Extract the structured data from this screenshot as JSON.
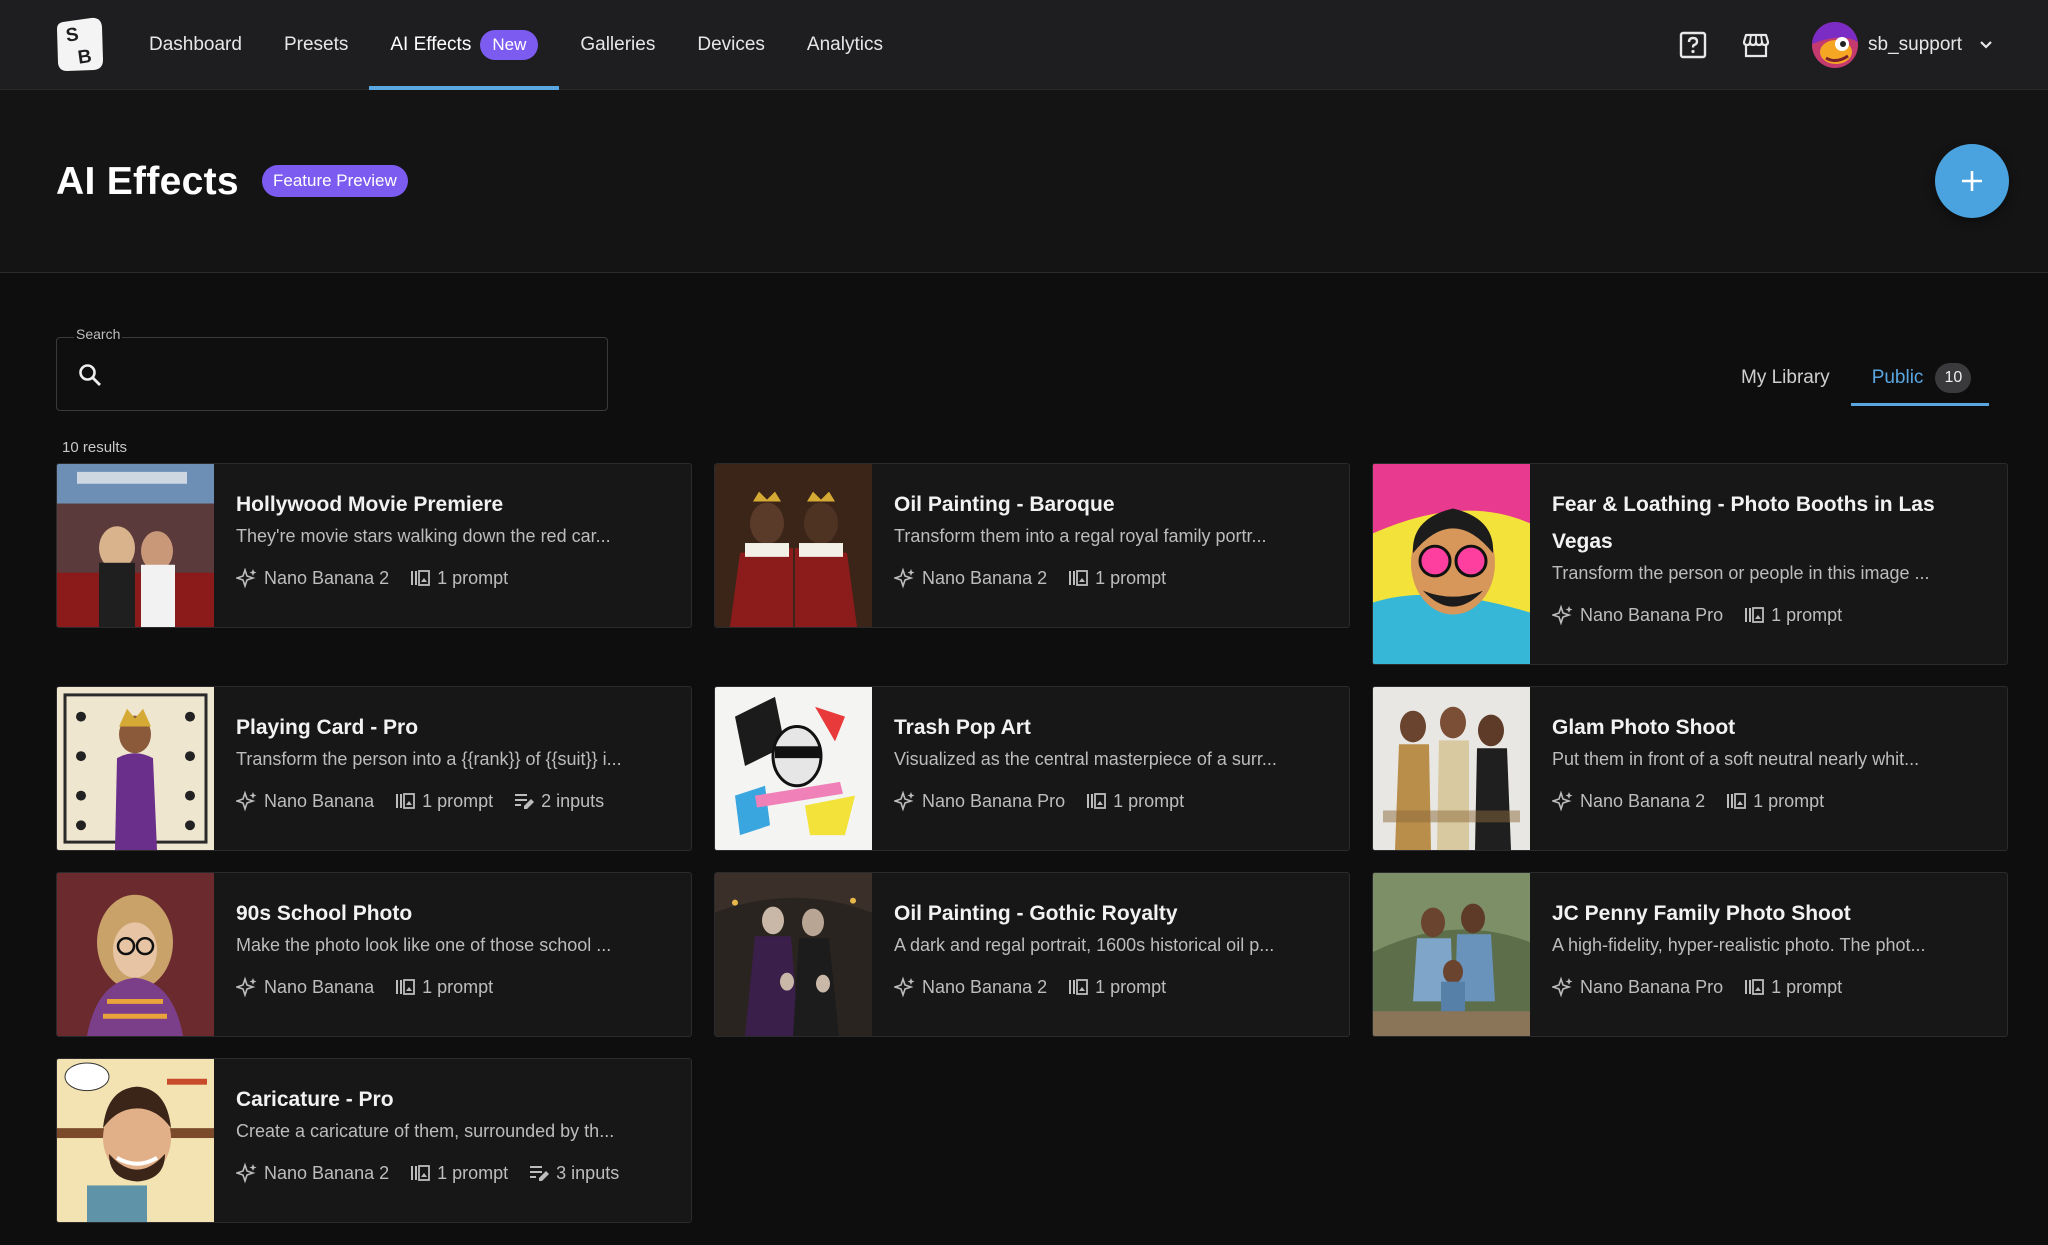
{
  "nav": {
    "items": [
      {
        "label": "Dashboard"
      },
      {
        "label": "Presets"
      },
      {
        "label": "AI Effects",
        "badge": "New",
        "active": true
      },
      {
        "label": "Galleries"
      },
      {
        "label": "Devices"
      },
      {
        "label": "Analytics"
      }
    ],
    "icons": [
      "help-icon",
      "store-icon"
    ],
    "user": {
      "name": "sb_support"
    }
  },
  "header": {
    "title": "AI Effects",
    "badge": "Feature Preview",
    "fab_icon": "plus-icon"
  },
  "search": {
    "label": "Search",
    "value": ""
  },
  "tabs": {
    "my_library": "My Library",
    "public": "Public",
    "public_count": "10"
  },
  "results_text": "10 results",
  "colors": {
    "accent": "#5aa6e0",
    "badge": "#7c5cf0",
    "background": "#0e0e0f"
  },
  "cards": [
    {
      "title": "Hollywood Movie Premiere",
      "desc": "They're movie stars walking down the red car...",
      "model": "Nano Banana 2",
      "prompts": "1 prompt"
    },
    {
      "title": "Oil Painting - Baroque",
      "desc": "Transform them into a regal royal family portr...",
      "model": "Nano Banana 2",
      "prompts": "1 prompt"
    },
    {
      "title": "Fear & Loathing - Photo Booths in Las Vegas",
      "desc": "Transform the person or people in this image ...",
      "model": "Nano Banana Pro",
      "prompts": "1 prompt"
    },
    {
      "title": "Playing Card - Pro",
      "desc": "Transform the person into a {{rank}} of {{suit}} i...",
      "model": "Nano Banana",
      "prompts": "1 prompt",
      "inputs": "2 inputs"
    },
    {
      "title": "Trash Pop Art",
      "desc": "Visualized as the central masterpiece of a surr...",
      "model": "Nano Banana Pro",
      "prompts": "1 prompt"
    },
    {
      "title": "Glam Photo Shoot",
      "desc": "Put them in front of a soft neutral nearly whit...",
      "model": "Nano Banana 2",
      "prompts": "1 prompt"
    },
    {
      "title": "90s School Photo",
      "desc": "Make the photo look like one of those school ...",
      "model": "Nano Banana",
      "prompts": "1 prompt"
    },
    {
      "title": "Oil Painting - Gothic Royalty",
      "desc": "A dark and regal portrait, 1600s historical oil p...",
      "model": "Nano Banana 2",
      "prompts": "1 prompt"
    },
    {
      "title": "JC Penny Family Photo Shoot",
      "desc": "A high-fidelity, hyper-realistic photo. The phot...",
      "model": "Nano Banana Pro",
      "prompts": "1 prompt"
    },
    {
      "title": "Caricature - Pro",
      "desc": "Create a caricature of them, surrounded by th...",
      "model": "Nano Banana 2",
      "prompts": "1 prompt",
      "inputs": "3 inputs"
    }
  ]
}
